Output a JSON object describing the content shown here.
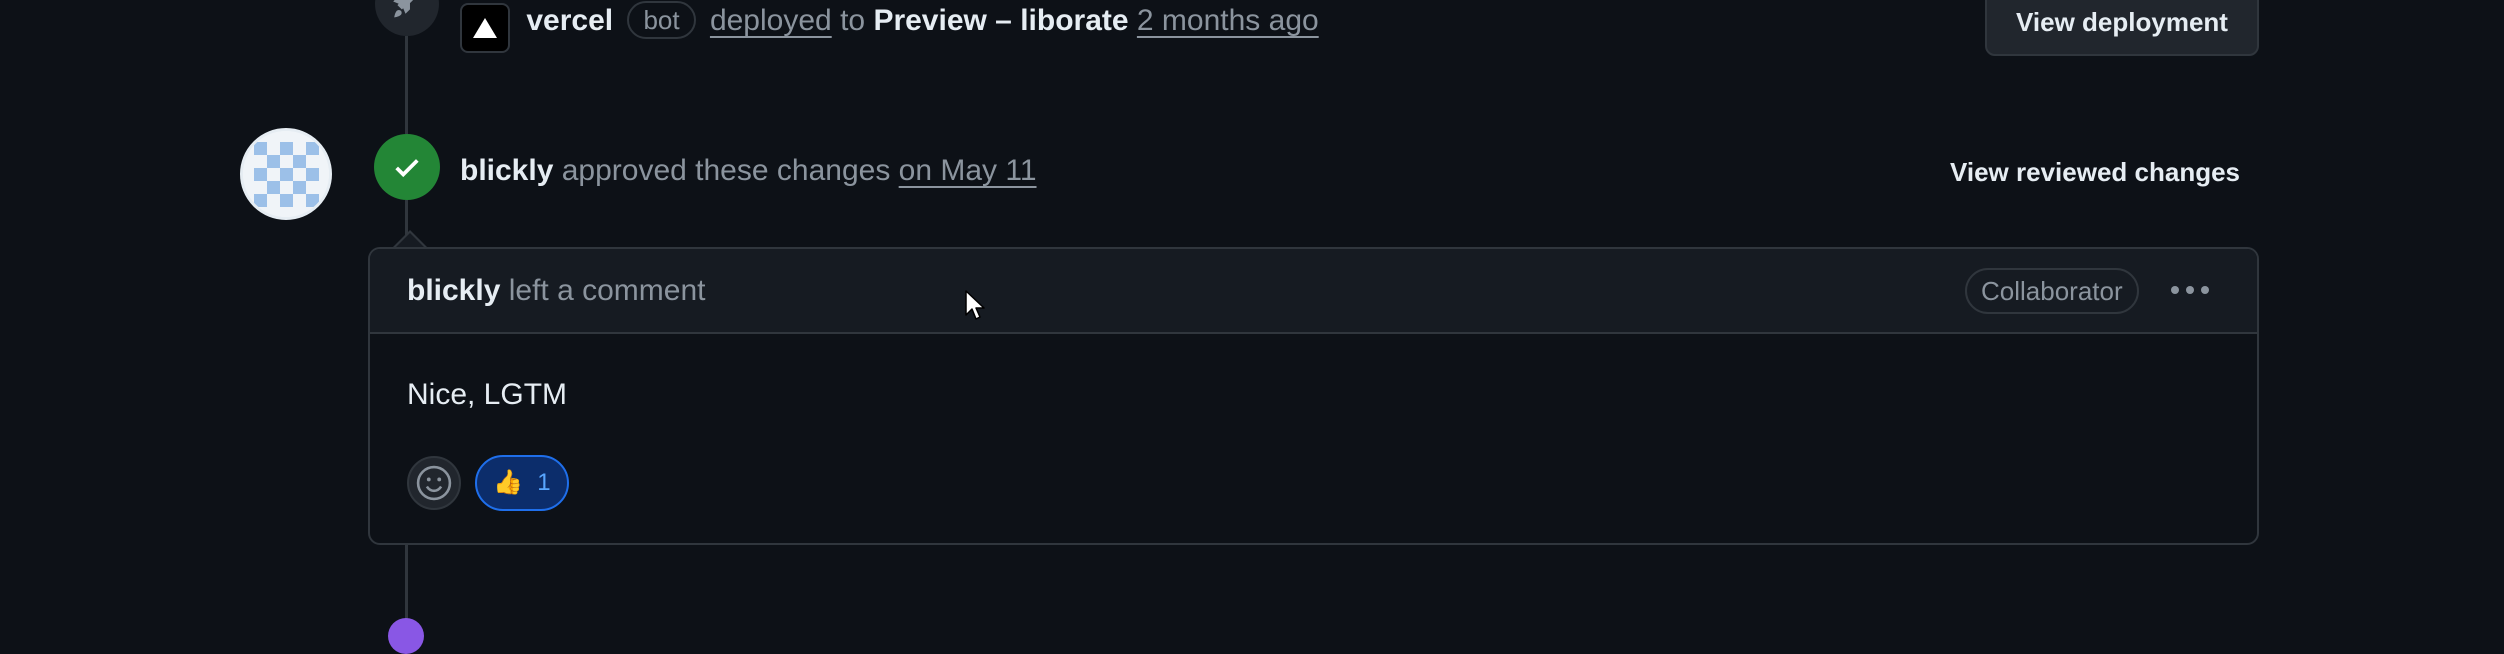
{
  "deployment": {
    "actor": "vercel",
    "bot_label": "bot",
    "action": "deployed",
    "connector": "to",
    "environment": "Preview – liborate",
    "time": "2 months ago",
    "button_label": "View deployment"
  },
  "review": {
    "reviewer": "blickly",
    "action": "approved these changes",
    "time": "on May 11",
    "button_label": "View reviewed changes"
  },
  "comment": {
    "author": "blickly",
    "action": "left a comment",
    "role_badge": "Collaborator",
    "body": "Nice, LGTM",
    "reactions": [
      {
        "emoji": "👍",
        "count": "1"
      }
    ]
  },
  "colors": {
    "background": "#0d1117",
    "approve_green": "#238636",
    "reaction_blue": "#1f6feb",
    "border": "#30363d"
  },
  "icons": [
    "rocket-icon",
    "vercel-triangle-icon",
    "check-icon",
    "smiley-icon",
    "kebab-menu-icon",
    "mouse-cursor-icon"
  ]
}
